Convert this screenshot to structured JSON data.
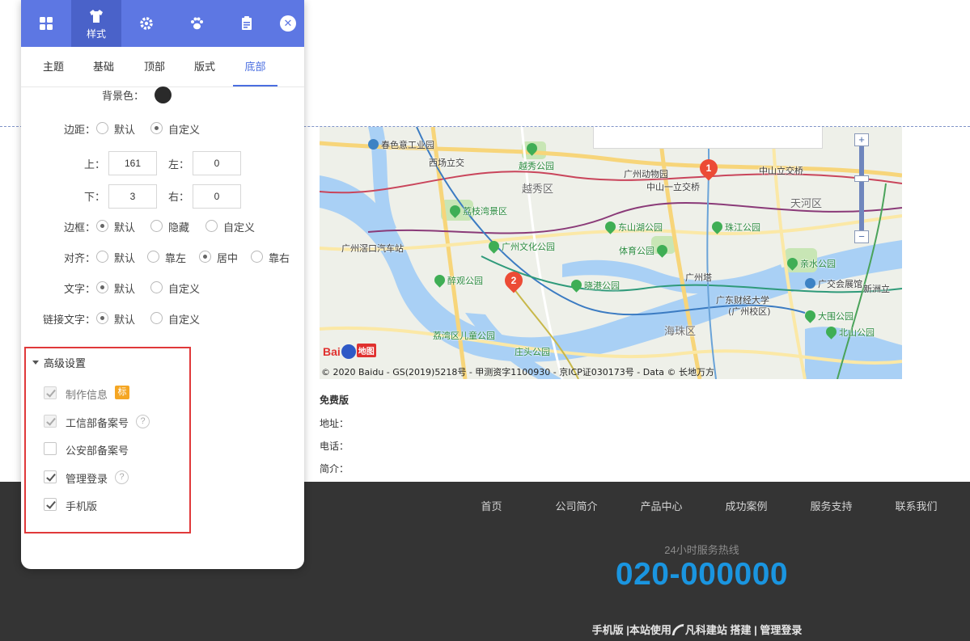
{
  "panel": {
    "active_tool_label": "样式",
    "tabs": [
      "主题",
      "基础",
      "顶部",
      "版式",
      "底部"
    ],
    "active_tab": "底部",
    "fields": {
      "bg_color_label": "背景色：",
      "margin_label": "边距：",
      "margin_options": [
        "默认",
        "自定义"
      ],
      "top_label": "上：",
      "top_value": "161",
      "left_label": "左：",
      "left_value": "0",
      "bottom_label": "下：",
      "bottom_value": "3",
      "right_label": "右：",
      "right_value": "0",
      "border_label": "边框：",
      "border_options": [
        "默认",
        "隐藏",
        "自定义"
      ],
      "align_label": "对齐：",
      "align_options": [
        "默认",
        "靠左",
        "居中",
        "靠右"
      ],
      "text_label": "文字：",
      "text_options": [
        "默认",
        "自定义"
      ],
      "link_text_label": "链接文字：",
      "link_text_options": [
        "默认",
        "自定义"
      ]
    },
    "advanced": {
      "title": "高级设置",
      "items": [
        {
          "label": "制作信息",
          "badge": "标"
        },
        {
          "label": "工信部备案号",
          "help": "?"
        },
        {
          "label": "公安部备案号"
        },
        {
          "label": "管理登录",
          "help": "?"
        },
        {
          "label": "手机版"
        }
      ]
    }
  },
  "map": {
    "labels": [
      "春色意工业园",
      "西场立交",
      "越秀公园",
      "广州动物园",
      "中山一立交桥",
      "中山立交桥",
      "越秀区",
      "天河区",
      "荔枝湾景区",
      "东山湖公园",
      "珠江公园",
      "广州滘口汽车站",
      "广州文化公园",
      "体育公园",
      "广州塔",
      "亲水公园",
      "广交会展馆",
      "醉观公园",
      "晓港公园",
      "新洲立",
      "广东财经大学",
      "(广州校区)",
      "大围公园",
      "荔湾区儿童公园",
      "海珠区",
      "北山公园",
      "庄头公园"
    ],
    "markers": [
      "1",
      "2"
    ],
    "zoom_in": "+",
    "zoom_out": "−",
    "logo_text": "Bai",
    "logo_text2": "地图",
    "copyright": "© 2020 Baidu - GS(2019)5218号 - 甲测资字1100930 - 京ICP证030173号 - Data © 长地万方"
  },
  "company": {
    "name": "免费版",
    "address_label": "地址：",
    "phone_label": "电话：",
    "intro_label": "简介："
  },
  "footer": {
    "nav": [
      "首页",
      "公司简介",
      "产品中心",
      "成功案例",
      "服务支持",
      "联系我们"
    ],
    "hotline_label": "24小时服务热线",
    "hotline_number": "020-000000",
    "links_prefix": "手机版 |本站使用",
    "links_brand": "凡科建站",
    "links_suffix": "搭建 | 管理登录"
  },
  "colors": {
    "accent": "#5d77e3",
    "hotline": "#1a95e0",
    "highlight_border": "#e0393a",
    "footer_bg": "#343434"
  }
}
